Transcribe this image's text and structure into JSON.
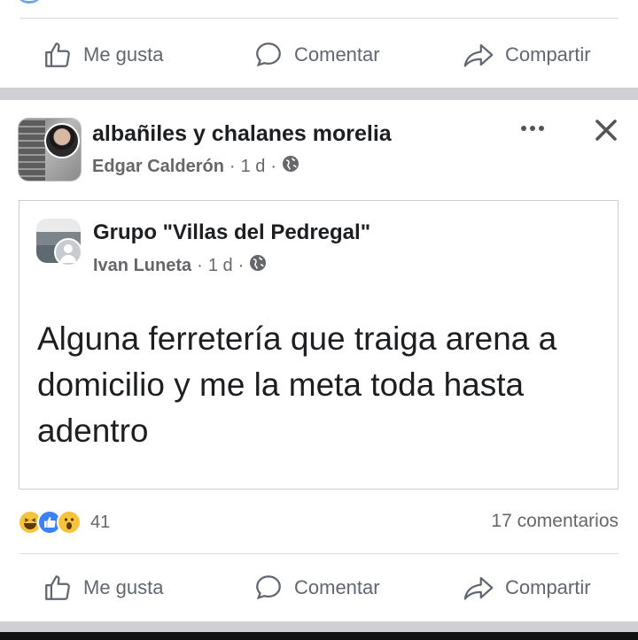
{
  "actions_top": {
    "like": "Me gusta",
    "comment": "Comentar",
    "share": "Compartir"
  },
  "post": {
    "group_name": "albañiles y chalanes morelia",
    "author": "Edgar Calderón",
    "time": "1 d",
    "separator": "·",
    "shared": {
      "group_name": "Grupo \"Villas del Pedregal\"",
      "author": "Ivan Luneta",
      "time": "1 d",
      "text": "Alguna ferretería que traiga arena a domicilio y me la  meta toda hasta adentro"
    },
    "reaction_count": "41",
    "comments": "17 comentarios"
  },
  "actions_bottom": {
    "like": "Me gusta",
    "comment": "Comentar",
    "share": "Compartir"
  },
  "icons": {
    "like": "thumbs-up-icon",
    "comment": "speech-bubble-icon",
    "share": "share-arrow-icon",
    "globe": "globe-icon",
    "more": "more-options-icon",
    "close": "close-icon"
  },
  "colors": {
    "text": "#1c1e21",
    "muted": "#65676b",
    "action": "#606770",
    "like_blue": "#3b82f6",
    "emoji_yellow": "#f7c33d"
  }
}
